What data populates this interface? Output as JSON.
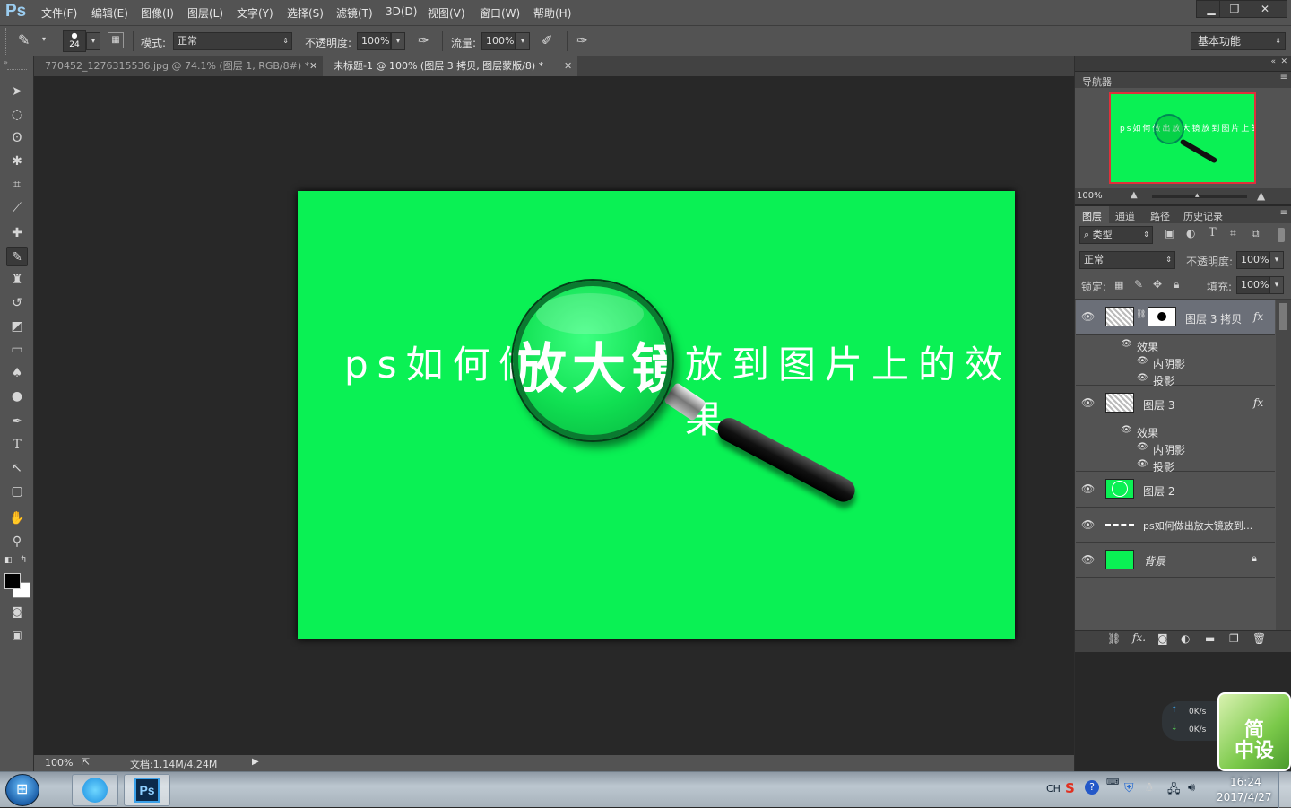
{
  "app": {
    "logo": "Ps"
  },
  "menu": [
    "文件(F)",
    "编辑(E)",
    "图像(I)",
    "图层(L)",
    "文字(Y)",
    "选择(S)",
    "滤镜(T)",
    "3D(D)",
    "视图(V)",
    "窗口(W)",
    "帮助(H)"
  ],
  "options": {
    "brush_size": "24",
    "mode_label": "模式:",
    "mode_value": "正常",
    "opacity_label": "不透明度:",
    "opacity_value": "100%",
    "flow_label": "流量:",
    "flow_value": "100%",
    "workspace": "基本功能"
  },
  "tabs": [
    {
      "label": "770452_1276315536.jpg @ 74.1% (图层 1, RGB/8#) *",
      "active": false
    },
    {
      "label": "未标题-1 @ 100% (图层 3 拷贝, 图层蒙版/8) *",
      "active": true
    }
  ],
  "canvas": {
    "bg_color": "#0af154",
    "text_left": "ps如何做出",
    "text_magnified": "放大镜",
    "text_right": "放到图片上的效果"
  },
  "status": {
    "zoom": "100%",
    "doc": "文档:1.14M/4.24M"
  },
  "navigator": {
    "title": "导航器",
    "zoom": "100%",
    "preview_text": "ps如何做出放大镜放到图片上的效果"
  },
  "layers_panel": {
    "tabs": [
      "图层",
      "通道",
      "路径",
      "历史记录"
    ],
    "filter": "类型",
    "blend": "正常",
    "opacity_label": "不透明度:",
    "opacity_value": "100%",
    "lock_label": "锁定:",
    "fill_label": "填充:",
    "fill_value": "100%",
    "layers": [
      {
        "name": "图层 3 拷贝",
        "fx": "fx",
        "effects_label": "效果",
        "effects": [
          "内阴影",
          "投影"
        ]
      },
      {
        "name": "图层 3",
        "fx": "fx",
        "effects_label": "效果",
        "effects": [
          "内阴影",
          "投影"
        ]
      },
      {
        "name": "图层 2"
      },
      {
        "name": "ps如何做出放大镜放到..."
      },
      {
        "name": "背景"
      }
    ]
  },
  "netspeed": {
    "up": "0K/s",
    "down": "0K/s"
  },
  "badge": {
    "line1": "简",
    "line2": "中设"
  },
  "taskbar": {
    "lang": "CH",
    "time": "16:24",
    "date": "2017/4/27",
    "ps_label": "Ps"
  }
}
